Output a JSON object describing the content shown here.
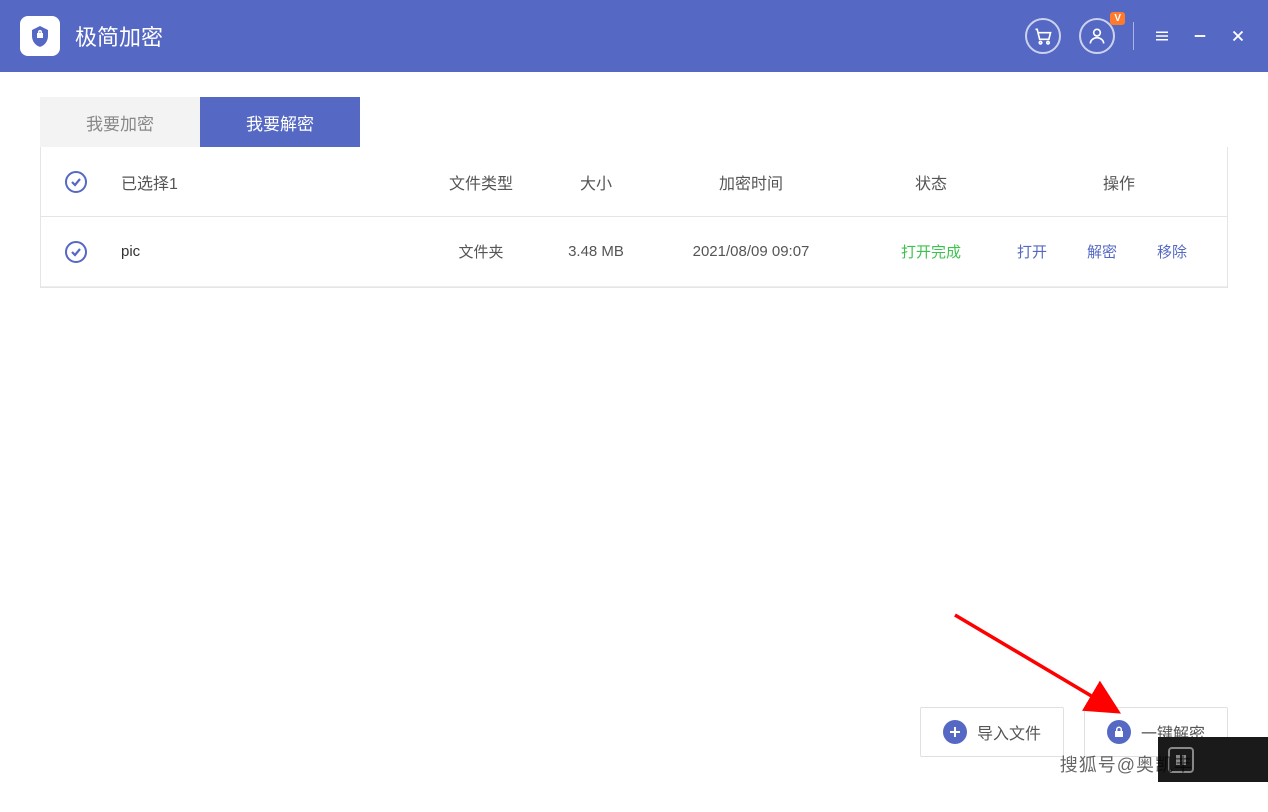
{
  "titlebar": {
    "app_name": "极简加密",
    "avatar_badge": "V"
  },
  "tabs": {
    "encrypt": "我要加密",
    "decrypt": "我要解密",
    "active": "decrypt"
  },
  "table": {
    "headers": {
      "selected": "已选择1",
      "type": "文件类型",
      "size": "大小",
      "time": "加密时间",
      "status": "状态",
      "actions": "操作"
    },
    "rows": [
      {
        "name": "pic",
        "type": "文件夹",
        "size": "3.48 MB",
        "time": "2021/08/09 09:07",
        "status": "打开完成",
        "actions": {
          "open": "打开",
          "decrypt": "解密",
          "remove": "移除"
        }
      }
    ]
  },
  "footer": {
    "import": "导入文件",
    "decrypt_all": "一键解密"
  },
  "watermark": "搜狐号@奥凯丰",
  "colors": {
    "primary": "#5568c4",
    "success": "#3ec24e"
  }
}
